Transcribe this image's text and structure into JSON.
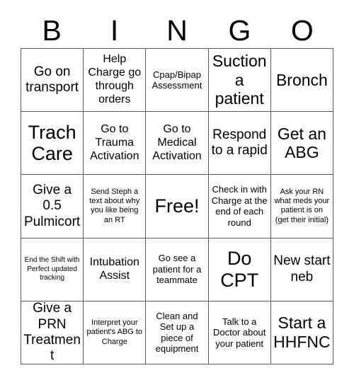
{
  "card": {
    "header_letters": [
      "B",
      "I",
      "N",
      "G",
      "O"
    ],
    "columns": 5,
    "rows": 5,
    "free_space": {
      "row": 2,
      "col": 2,
      "label": "Free!"
    },
    "grid": [
      [
        {
          "text": "Go on transport",
          "size": "lg"
        },
        {
          "text": "Help Charge go through orders",
          "size": "md"
        },
        {
          "text": "Cpap/Bipap Assessment",
          "size": "sm"
        },
        {
          "text": "Suction a patient",
          "size": "xl"
        },
        {
          "text": "Bronch",
          "size": "xl"
        }
      ],
      [
        {
          "text": "Trach Care",
          "size": "xxl"
        },
        {
          "text": "Go to Trauma Activation",
          "size": "md"
        },
        {
          "text": "Go to Medical Activation",
          "size": "md"
        },
        {
          "text": "Respond to a rapid",
          "size": "lg"
        },
        {
          "text": "Get an ABG",
          "size": "xl"
        }
      ],
      [
        {
          "text": "Give a 0.5 Pulmicort",
          "size": "lg"
        },
        {
          "text": "Send Steph a text about why you like being an RT",
          "size": "xs"
        },
        {
          "text": "Free!",
          "size": "xxl"
        },
        {
          "text": "Check in with Charge at the end of each round",
          "size": "sm"
        },
        {
          "text": "Ask your RN what meds your patient is on (get their initial)",
          "size": "xs"
        }
      ],
      [
        {
          "text": "End the Shift with Perfect updated tracking",
          "size": "xxs"
        },
        {
          "text": "Intubation Assist",
          "size": "md"
        },
        {
          "text": "Go see a patient for a teammate",
          "size": "sm"
        },
        {
          "text": "Do CPT",
          "size": "xxl"
        },
        {
          "text": "New start neb",
          "size": "lg"
        }
      ],
      [
        {
          "text": "Give a PRN Treatment",
          "size": "lg"
        },
        {
          "text": "Interpret your patient's ABG to Charge",
          "size": "xs"
        },
        {
          "text": "Clean and Set up a piece of equipment",
          "size": "sm"
        },
        {
          "text": "Talk to a Doctor about your patient",
          "size": "sm"
        },
        {
          "text": "Start a HHFNC",
          "size": "xl"
        }
      ]
    ]
  },
  "colors": {
    "background": "#ffffff",
    "text": "#000000",
    "grid_line": "#5a5a5a"
  }
}
